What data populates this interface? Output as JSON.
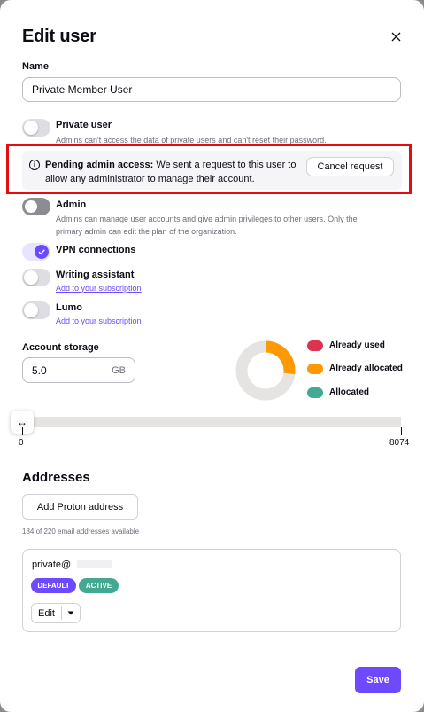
{
  "modal": {
    "title": "Edit user",
    "close_icon": "close-icon"
  },
  "name_field": {
    "label": "Name",
    "value": "Private Member User"
  },
  "private_user": {
    "label": "Private user",
    "hint": "Admins can't access the data of private users and can't reset their password.",
    "enabled": false
  },
  "pending_notice": {
    "icon": "info-icon",
    "strong": "Pending admin access:",
    "text": " We sent a request to this user to allow any administrator to manage their account.",
    "cancel_label": "Cancel request"
  },
  "admin": {
    "label": "Admin",
    "hint_line1": "Admins can manage user accounts and give admin privileges to other users. Only the",
    "hint_line2": "primary admin can edit the plan of the organization.",
    "enabled": false
  },
  "vpn": {
    "label": "VPN connections",
    "enabled": true
  },
  "writing_assistant": {
    "label": "Writing assistant",
    "link": "Add to your subscription",
    "enabled": false
  },
  "lumo": {
    "label": "Lumo",
    "link": "Add to your subscription",
    "enabled": false
  },
  "storage": {
    "label": "Account storage",
    "value": "5.0",
    "unit": "GB",
    "slider_min": "0",
    "slider_max": "8074",
    "slider_value_fraction": 0,
    "handle_icon": "left-right-arrows-icon",
    "legend": [
      {
        "label": "Already used",
        "color": "#dc3251"
      },
      {
        "label": "Already allocated",
        "color": "#ff9900"
      },
      {
        "label": "Allocated",
        "color": "#44a992"
      }
    ],
    "donut": {
      "track_color": "#e5e4e2",
      "allocated_fraction": 0.27
    }
  },
  "addresses": {
    "heading": "Addresses",
    "add_button": "Add Proton address",
    "availability": "184 of 220 email addresses available",
    "items": [
      {
        "email": "private@",
        "badges": [
          {
            "label": "DEFAULT",
            "color": "#6d4aff"
          },
          {
            "label": "ACTIVE",
            "color": "#44a992"
          }
        ],
        "edit_label": "Edit",
        "dropdown_icon": "caret-down-icon"
      }
    ]
  },
  "footer": {
    "save_label": "Save"
  }
}
